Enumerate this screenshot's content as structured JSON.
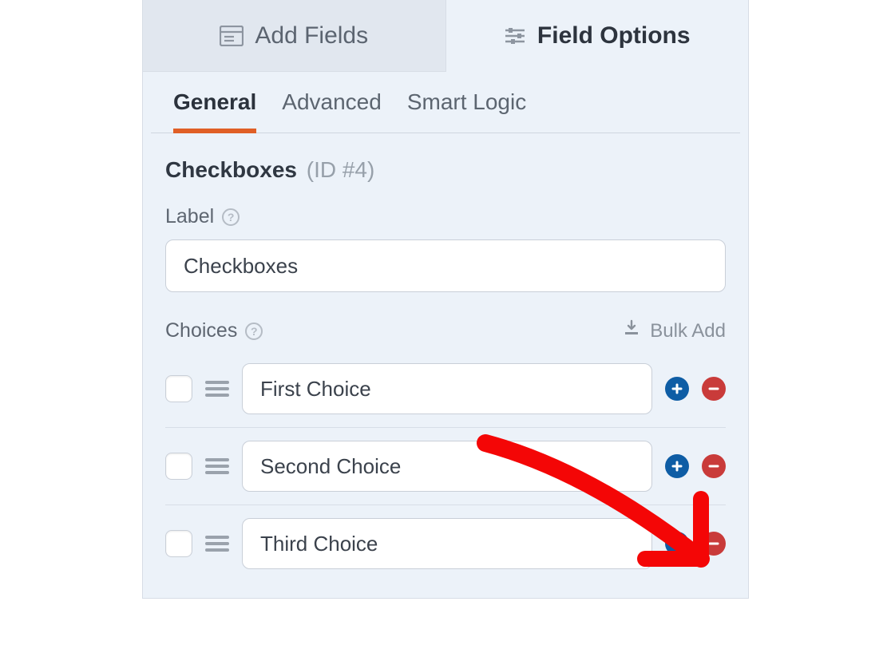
{
  "top_tabs": {
    "add_fields": "Add Fields",
    "field_options": "Field Options"
  },
  "sub_tabs": {
    "general": "General",
    "advanced": "Advanced",
    "smart_logic": "Smart Logic"
  },
  "field": {
    "type_label": "Checkboxes",
    "id_label": "(ID #4)"
  },
  "label_section": {
    "title": "Label",
    "value": "Checkboxes"
  },
  "choices_section": {
    "title": "Choices",
    "bulk_add": "Bulk Add",
    "items": [
      {
        "value": "First Choice"
      },
      {
        "value": "Second Choice"
      },
      {
        "value": "Third Choice"
      }
    ]
  }
}
